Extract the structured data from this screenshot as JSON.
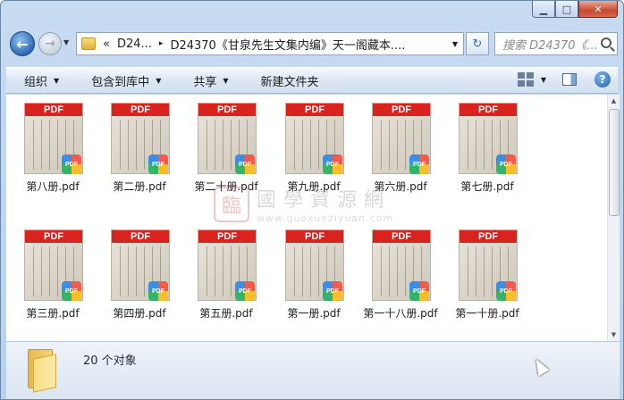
{
  "window": {
    "minimize_glyph": "▁",
    "maximize_glyph": "□",
    "close_glyph": "✕"
  },
  "nav": {
    "back_glyph": "←",
    "forward_glyph": "→",
    "history_glyph": "▼",
    "address_chevron": "«",
    "address_root": "D24...",
    "address_sep": "▸",
    "address_current": "D24370《甘泉先生文集内编》天一阁藏本....",
    "address_drop": "▼",
    "refresh_glyph": "↻",
    "search_placeholder": "搜索 D24370《..."
  },
  "toolbar": {
    "organize": "组织",
    "include_library": "包含到库中",
    "share": "共享",
    "new_folder": "新建文件夹",
    "help_glyph": "?"
  },
  "files": [
    {
      "name": "第八册.pdf"
    },
    {
      "name": "第二册.pdf"
    },
    {
      "name": "第二十册.pdf"
    },
    {
      "name": "第九册.pdf"
    },
    {
      "name": "第六册.pdf"
    },
    {
      "name": "第七册.pdf"
    },
    {
      "name": "第三册.pdf"
    },
    {
      "name": "第四册.pdf"
    },
    {
      "name": "第五册.pdf"
    },
    {
      "name": "第一册.pdf"
    },
    {
      "name": "第一十八册.pdf"
    },
    {
      "name": "第一十册.pdf"
    }
  ],
  "pdf_band_label": "PDF",
  "pdf_badge_label": "PDF",
  "watermark": {
    "seal": "臨",
    "text": "國學資源網",
    "url": "www.guoxueziyuan.com"
  },
  "status": {
    "count_text": "20 个对象"
  },
  "colors": {
    "pdf_red": "#d8231f",
    "chrome_blue": "#c7dbf1"
  }
}
